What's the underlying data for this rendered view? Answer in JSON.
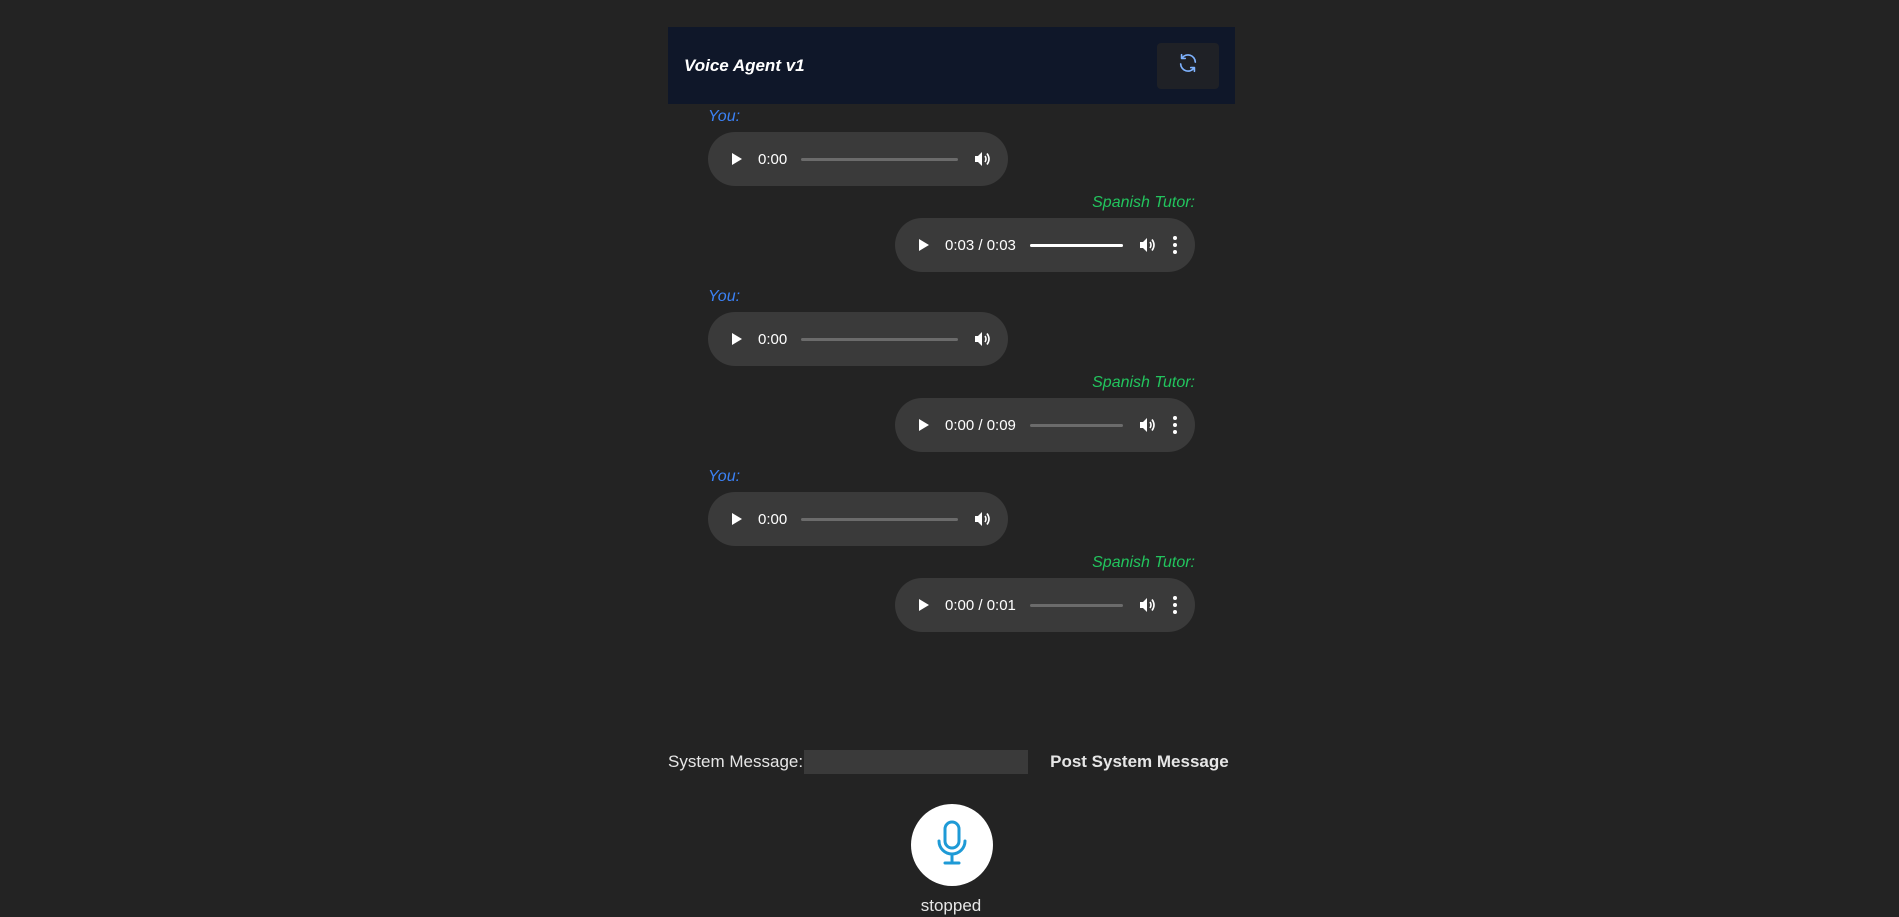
{
  "header": {
    "title": "Voice Agent v1",
    "refresh_icon": "refresh-icon"
  },
  "messages": [
    {
      "speaker": "You:",
      "role": "user",
      "time": "0:00",
      "progress": 0
    },
    {
      "speaker": "Spanish Tutor:",
      "role": "tutor",
      "time": "0:03 / 0:03",
      "progress": 1.0
    },
    {
      "speaker": "You:",
      "role": "user",
      "time": "0:00",
      "progress": 0
    },
    {
      "speaker": "Spanish Tutor:",
      "role": "tutor",
      "time": "0:00 / 0:09",
      "progress": 0
    },
    {
      "speaker": "You:",
      "role": "user",
      "time": "0:00",
      "progress": 0
    },
    {
      "speaker": "Spanish Tutor:",
      "role": "tutor",
      "time": "0:00 / 0:01",
      "progress": 0
    }
  ],
  "system": {
    "label": "System Message:",
    "input_value": "",
    "post_label": "Post System Message"
  },
  "mic": {
    "icon": "microphone-icon",
    "status": "stopped"
  },
  "colors": {
    "background": "#232323",
    "header_bg": "#0f1729",
    "user_label": "#3b82f6",
    "tutor_label": "#22c55e",
    "mic_accent": "#1e9ad6"
  }
}
